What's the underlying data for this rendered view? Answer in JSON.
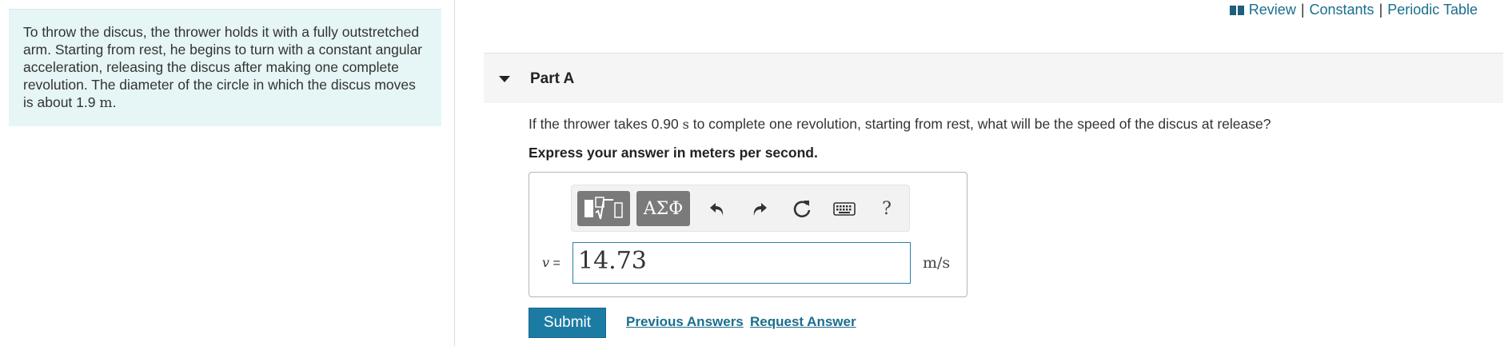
{
  "problem": {
    "text": "To throw the discus, the thrower holds it with a fully outstretched arm. Starting from rest, he begins to turn with a constant angular acceleration, releasing the discus after making one complete revolution. The diameter of the circle in which the discus moves is about 1.9",
    "unit": "m",
    "end": "."
  },
  "top_links": {
    "icon": "book-icon",
    "review": "Review",
    "sep": "|",
    "constants": "Constants",
    "periodic": "Periodic Table"
  },
  "part": {
    "title": "Part A"
  },
  "question": {
    "pre": "If the thrower takes 0.90",
    "unit": "s",
    "post": "to complete one revolution, starting from rest, what will be the speed of the discus at release?",
    "instruction": "Express your answer in meters per second."
  },
  "toolbar": {
    "templates_icon": "templates-icon",
    "greek": "ΑΣΦ",
    "help": "?"
  },
  "answer": {
    "var": "v",
    "eq": "=",
    "value": "14.73",
    "unit": "m/s"
  },
  "actions": {
    "submit": "Submit",
    "previous": "Previous Answers",
    "request": "Request Answer"
  },
  "colors": {
    "accent": "#1c7ba3",
    "problem_bg": "#e6f5f5",
    "toolbar_btn": "#7a7a7a"
  }
}
